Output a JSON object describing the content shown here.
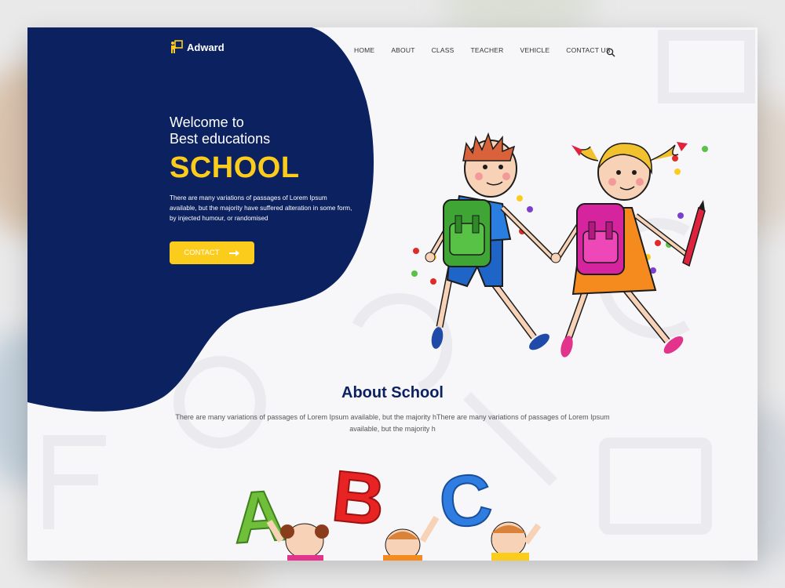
{
  "brand": {
    "name": "Adward"
  },
  "nav": {
    "items": [
      "HOME",
      "ABOUT",
      "CLASS",
      "TEACHER",
      "VEHICLE",
      "CONTACT US"
    ]
  },
  "hero": {
    "welcome_line1": "Welcome to",
    "welcome_line2": "Best educations",
    "headline": "SCHOOL",
    "text": "There are many variations of passages of Lorem Ipsum available, but the majority have suffered alteration in some form, by injected humour, or randomised",
    "cta_label": "CONTACT"
  },
  "about": {
    "title": "About School",
    "text": "There are many variations of passages of Lorem Ipsum available, but the majority hThere are many variations of passages of Lorem Ipsum available, but the majority h"
  },
  "abc_letters": [
    "A",
    "B",
    "C"
  ],
  "icons": [
    "logo-icon",
    "search-icon",
    "arrow-right-icon"
  ],
  "colors": {
    "navy": "#0b2160",
    "accent": "#fccc1d",
    "background": "#f7f7f9"
  }
}
